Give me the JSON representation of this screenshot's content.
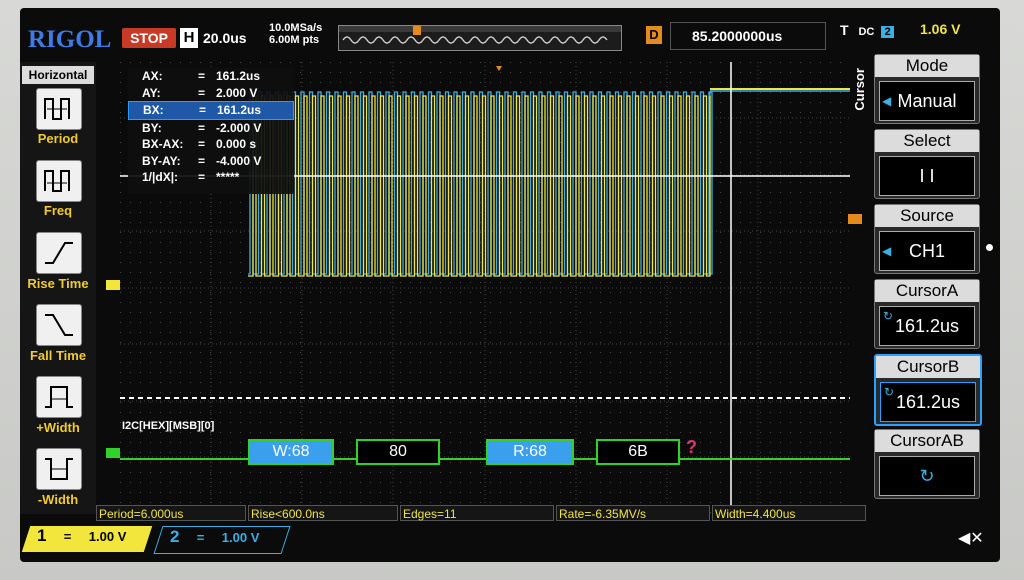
{
  "brand": "RIGOL",
  "run_state": "STOP",
  "timebase": {
    "label": "H",
    "value": "20.0us",
    "sample_rate": "10.0MSa/s",
    "memory": "6.00M pts"
  },
  "delay": {
    "label": "D",
    "value": "85.2000000us"
  },
  "trigger": {
    "label": "T",
    "coupling": "DC",
    "channel": "2",
    "level": "1.06 V"
  },
  "horizontal_panel": {
    "title": "Horizontal",
    "items": [
      {
        "label": "Period"
      },
      {
        "label": "Freq"
      },
      {
        "label": "Rise Time"
      },
      {
        "label": "Fall Time"
      },
      {
        "label": "+Width"
      },
      {
        "label": "-Width"
      }
    ]
  },
  "cursor_readout": [
    {
      "label": "AX:",
      "eq": "=",
      "value": "161.2us"
    },
    {
      "label": "AY:",
      "eq": "=",
      "value": "2.000 V"
    },
    {
      "label": "BX:",
      "eq": "=",
      "value": "161.2us"
    },
    {
      "label": "BY:",
      "eq": "=",
      "value": "-2.000 V"
    },
    {
      "label": "BX-AX:",
      "eq": "=",
      "value": "0.000 s"
    },
    {
      "label": "BY-AY:",
      "eq": "=",
      "value": "-4.000 V"
    },
    {
      "label": "1/|dX|:",
      "eq": "=",
      "value": "*****"
    }
  ],
  "cursor_menu": {
    "side_label": "Cursor",
    "mode": {
      "title": "Mode",
      "value": "Manual"
    },
    "select": {
      "title": "Select",
      "value": "I I"
    },
    "source": {
      "title": "Source",
      "value": "CH1"
    },
    "cursor_a": {
      "title": "CursorA",
      "value": "161.2us"
    },
    "cursor_b": {
      "title": "CursorB",
      "value": "161.2us"
    },
    "cursor_ab": {
      "title": "CursorAB"
    }
  },
  "decoder": {
    "label": "I2C[HEX][MSB][0]",
    "packets": [
      "W:68",
      "80",
      "R:68",
      "6B"
    ],
    "unknown": "?"
  },
  "measurements": [
    "Period=6.000us",
    "Rise<600.0ns",
    "Edges=11",
    "Rate=-6.35MV/s",
    "Width=4.400us"
  ],
  "channels": [
    {
      "num": "1",
      "coupling": "=",
      "scale": "1.00 V",
      "color": "#f2e63c"
    },
    {
      "num": "2",
      "coupling": "=",
      "scale": "1.00 V",
      "color": "#3ab0e6"
    }
  ]
}
